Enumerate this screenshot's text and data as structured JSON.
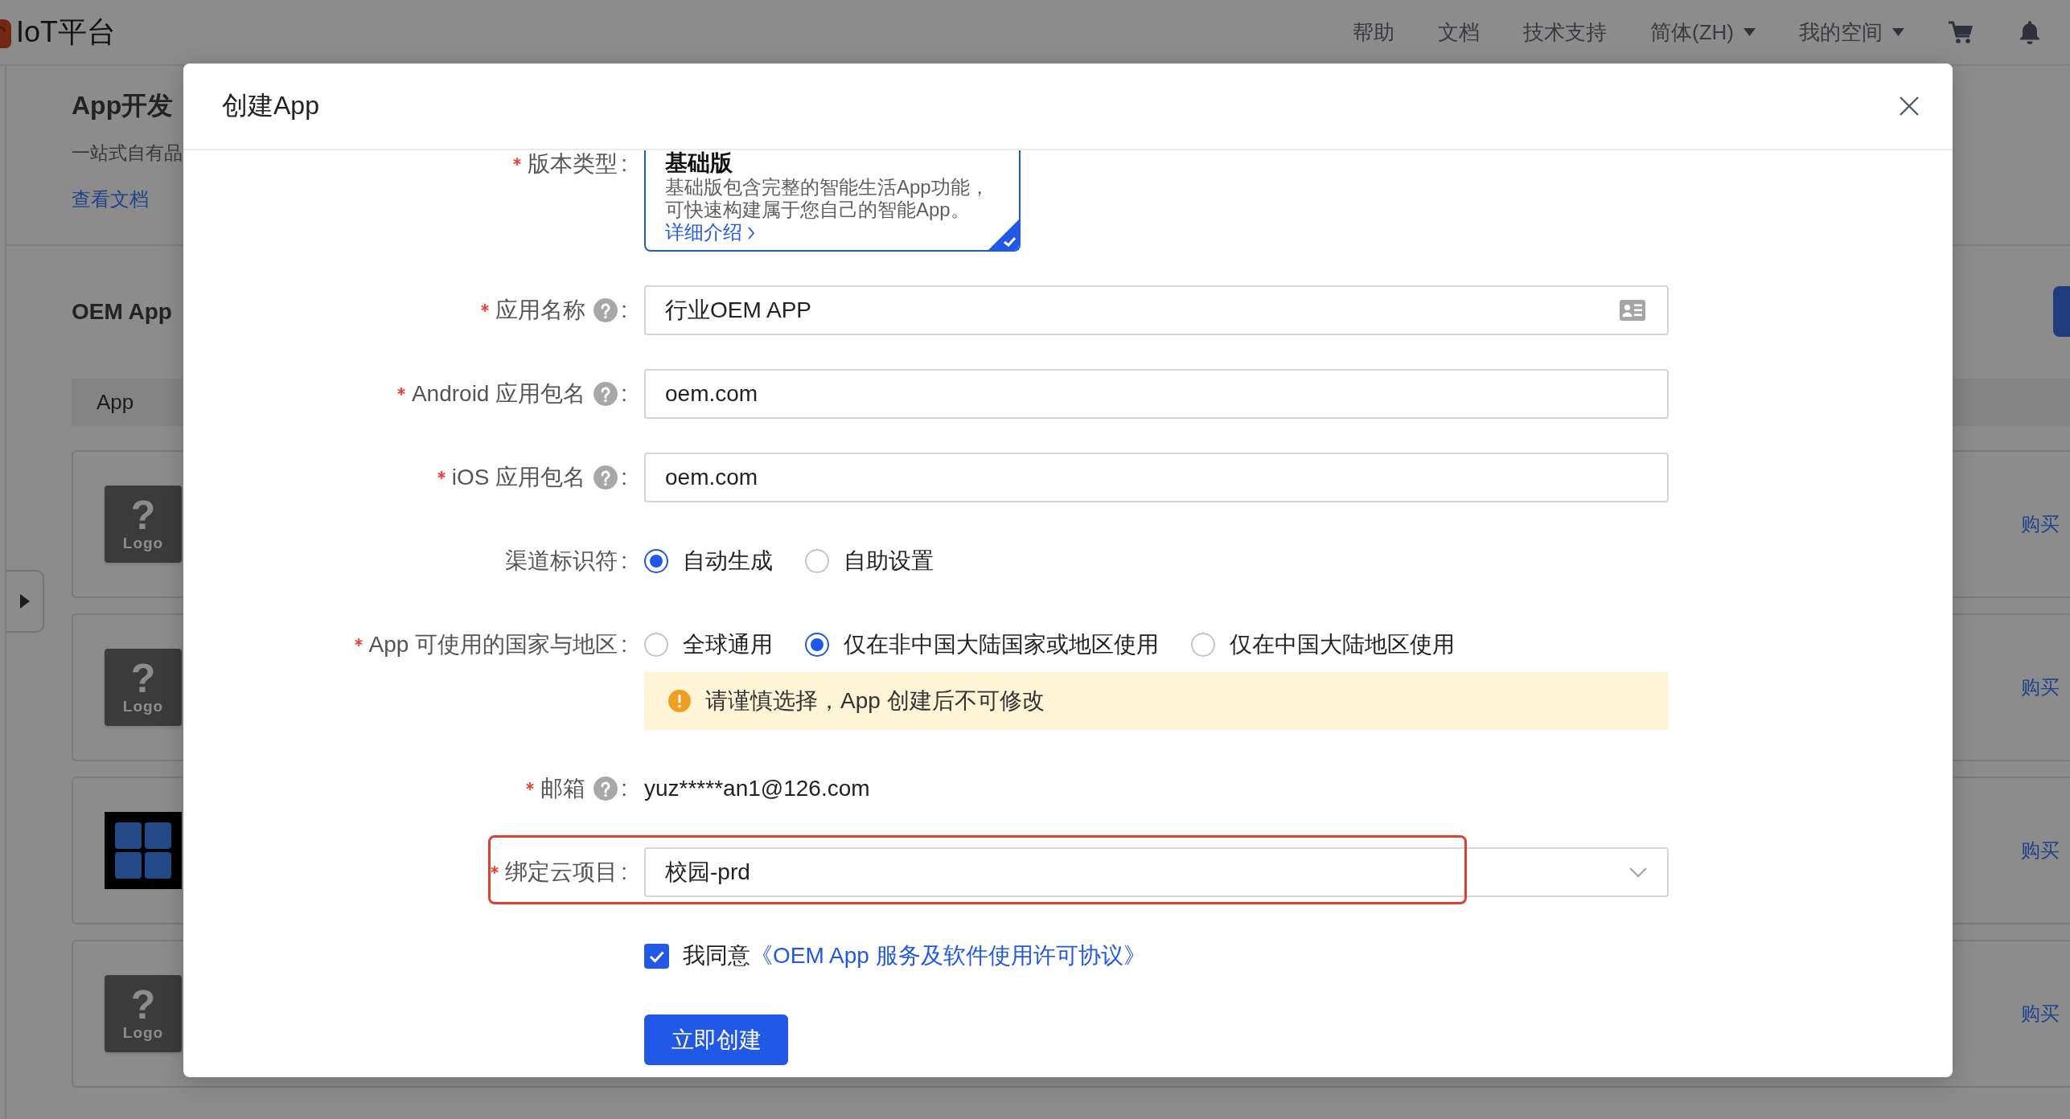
{
  "header": {
    "logo": "IoT平台",
    "nav": [
      {
        "label": "帮助",
        "has_menu": false
      },
      {
        "label": "文档",
        "has_menu": false
      },
      {
        "label": "技术支持",
        "has_menu": false
      },
      {
        "label": "简体(ZH)",
        "has_menu": true
      },
      {
        "label": "我的空间",
        "has_menu": true
      }
    ]
  },
  "sidebar_toggle": {
    "collapsed": true
  },
  "page": {
    "title": "App开发",
    "subtitle": "一站式自有品",
    "doc_link": "查看文档",
    "section_title": "OEM App",
    "table": {
      "columns": [
        "App"
      ],
      "rows": [
        {
          "logo": {
            "kind": "placeholder",
            "mark": "?",
            "caption": "Logo"
          },
          "action": "购买"
        },
        {
          "logo": {
            "kind": "placeholder",
            "mark": "?",
            "caption": "Logo"
          },
          "action": "购买"
        },
        {
          "logo": {
            "kind": "grid"
          },
          "action": "购买"
        },
        {
          "logo": {
            "kind": "placeholder",
            "mark": "?",
            "caption": "Logo"
          },
          "action": "购买"
        }
      ]
    }
  },
  "dialog": {
    "title": "创建App",
    "form": [
      {
        "kind": "version_card",
        "label": "版本类型",
        "required": true,
        "help": false,
        "colon": ":",
        "highlighted": false,
        "card": {
          "title": "基础版",
          "description": "基础版包含完整的智能生活App功能，可快速构建属于您自己的智能App。",
          "link": "详细介绍",
          "selected": true
        }
      },
      {
        "kind": "input",
        "label": "应用名称",
        "required": true,
        "help": true,
        "colon": ":",
        "highlighted": false,
        "value": "行业OEM APP",
        "suffix_icon": true
      },
      {
        "kind": "input",
        "label": "Android 应用包名",
        "required": true,
        "help": true,
        "colon": ":",
        "highlighted": false,
        "value": "oem.com",
        "suffix_icon": false
      },
      {
        "kind": "input",
        "label": "iOS 应用包名",
        "required": true,
        "help": true,
        "colon": ":",
        "highlighted": false,
        "value": "oem.com",
        "suffix_icon": false
      },
      {
        "kind": "radio",
        "label": "渠道标识符",
        "required": false,
        "help": false,
        "colon": ":",
        "highlighted": false,
        "options": [
          {
            "label": "自动生成",
            "selected": true
          },
          {
            "label": "自助设置",
            "selected": false
          }
        ]
      },
      {
        "kind": "radio",
        "label": "App 可使用的国家与地区",
        "required": true,
        "help": false,
        "colon": ":",
        "highlighted": false,
        "options": [
          {
            "label": "全球通用",
            "selected": false
          },
          {
            "label": "仅在非中国大陆国家或地区使用",
            "selected": true
          },
          {
            "label": "仅在中国大陆地区使用",
            "selected": false
          }
        ],
        "notice": "请谨慎选择，App 创建后不可修改"
      },
      {
        "kind": "text",
        "label": "邮箱",
        "required": true,
        "help": true,
        "colon": ":",
        "highlighted": false,
        "value": "yuz*****an1@126.com"
      },
      {
        "kind": "select",
        "label": "绑定云项目",
        "required": true,
        "help": false,
        "colon": ":",
        "highlighted": true,
        "value": "校园-prd"
      }
    ],
    "agreement": {
      "checked": true,
      "text": "我同意",
      "link": "《OEM App 服务及软件使用许可协议》"
    },
    "submit": "立即创建"
  }
}
